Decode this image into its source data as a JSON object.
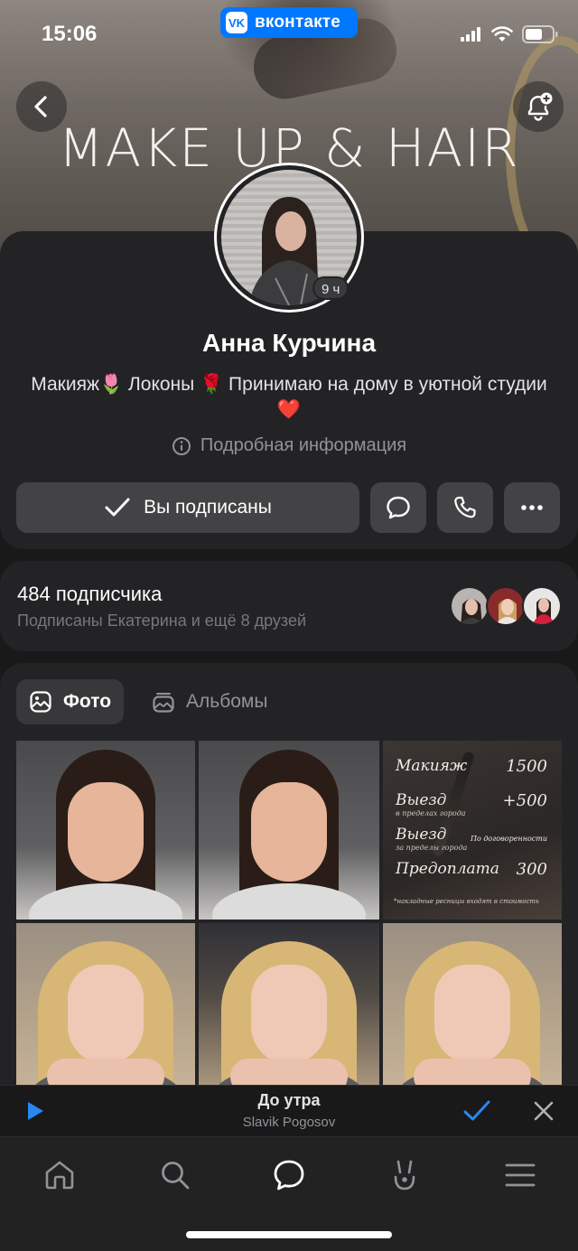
{
  "status_bar": {
    "time": "15:06",
    "app_badge": "вконтакте",
    "app_badge_logo": "VK"
  },
  "cover": {
    "title": "MAKE UP & HAIR"
  },
  "profile": {
    "story_age": "9 ч",
    "name": "Анна Курчина",
    "bio": "Макияж🌷 Локоны 🌹 Принимаю на дому в уютной студии ❤️",
    "details_label": "Подробная информация",
    "subscribe_label": "Вы подписаны"
  },
  "followers": {
    "count_label": "484 подписчика",
    "friends_label": "Подписаны Екатерина и ещё 8 друзей"
  },
  "media_tabs": {
    "photos": "Фото",
    "albums": "Альбомы"
  },
  "price_list": {
    "rows": [
      {
        "label": "Макияж",
        "value": "1500",
        "sub": ""
      },
      {
        "label": "Выезд",
        "value": "+500",
        "sub": "в пределах города"
      },
      {
        "label": "Выезд",
        "value": "По договоренности",
        "sub": "за пределы города"
      },
      {
        "label": "Предоплата",
        "value": "300",
        "sub": ""
      }
    ],
    "note": "*накладные ресницы входят в стоимость"
  },
  "player": {
    "title": "До утра",
    "artist": "Slavik Pogosov"
  },
  "colors": {
    "accent": "#0077ff",
    "card": "#232325",
    "background": "#19191a",
    "button": "#434345"
  },
  "icons": {
    "back": "chevron-left-icon",
    "notify": "bell-plus-icon",
    "check": "checkmark-icon",
    "message": "message-bubble-icon",
    "call": "phone-icon",
    "more": "more-dots-icon",
    "info": "info-icon",
    "photo": "image-icon",
    "albums": "albums-icon",
    "play": "play-icon",
    "added": "checkmark-icon",
    "close": "close-icon",
    "nav": [
      "home-icon",
      "search-icon",
      "messenger-icon",
      "clips-icon",
      "menu-icon"
    ]
  }
}
